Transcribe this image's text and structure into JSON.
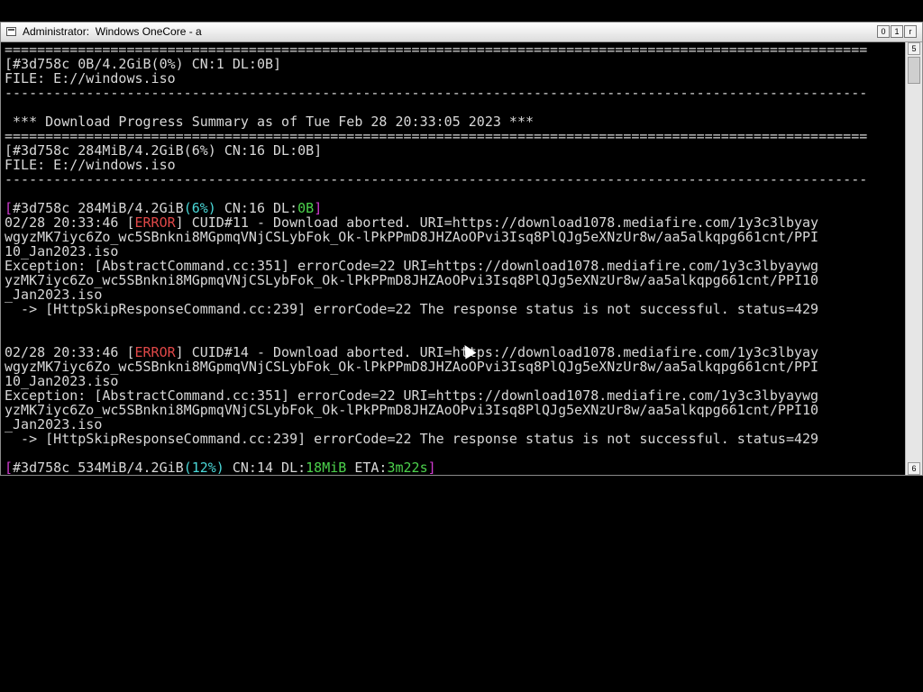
{
  "window": {
    "title": "Administrator:  Windows OneCore - a",
    "buttons": [
      "0",
      "1",
      "r"
    ],
    "scroll": {
      "up": "5",
      "down": "6"
    }
  },
  "console": {
    "lines": [
      {
        "segments": [
          {
            "text": "=========================================================================================================="
          }
        ]
      },
      {
        "segments": [
          {
            "text": "[#3d758c 0B/4.2GiB(0%) CN:1 DL:0B]"
          }
        ]
      },
      {
        "segments": [
          {
            "text": "FILE: E://windows.iso"
          }
        ]
      },
      {
        "segments": [
          {
            "text": "----------------------------------------------------------------------------------------------------------"
          }
        ]
      },
      {
        "segments": [
          {
            "text": ""
          }
        ]
      },
      {
        "segments": [
          {
            "text": " *** Download Progress Summary as of Tue Feb 28 20:33:05 2023 ***"
          }
        ]
      },
      {
        "segments": [
          {
            "text": "=========================================================================================================="
          }
        ]
      },
      {
        "segments": [
          {
            "text": "[#3d758c 284MiB/4.2GiB(6%) CN:16 DL:0B]"
          }
        ]
      },
      {
        "segments": [
          {
            "text": "FILE: E://windows.iso"
          }
        ]
      },
      {
        "segments": [
          {
            "text": "----------------------------------------------------------------------------------------------------------"
          }
        ]
      },
      {
        "segments": [
          {
            "text": ""
          }
        ]
      },
      {
        "segments": [
          {
            "text": "[",
            "color": "mag"
          },
          {
            "text": "#3d758c 284MiB/4.2GiB"
          },
          {
            "text": "(6%)",
            "color": "cyan"
          },
          {
            "text": " CN:16 DL:"
          },
          {
            "text": "0B",
            "color": "grn"
          },
          {
            "text": "]",
            "color": "mag"
          }
        ]
      },
      {
        "segments": [
          {
            "text": "02/28 20:33:46 ["
          },
          {
            "text": "ERROR",
            "color": "red"
          },
          {
            "text": "] CUID#11 - Download aborted. URI=https://download1078.mediafire.com/1y3c3lbyay"
          }
        ]
      },
      {
        "segments": [
          {
            "text": "wgyzMK7iyc6Zo_wc5SBnkni8MGpmqVNjCSLybFok_Ok-lPkPPmD8JHZAoOPvi3Isq8PlQJg5eXNzUr8w/aa5alkqpg661cnt/PPI"
          }
        ]
      },
      {
        "segments": [
          {
            "text": "10_Jan2023.iso"
          }
        ]
      },
      {
        "segments": [
          {
            "text": "Exception: [AbstractCommand.cc:351] errorCode=22 URI=https://download1078.mediafire.com/1y3c3lbyaywg"
          }
        ]
      },
      {
        "segments": [
          {
            "text": "yzMK7iyc6Zo_wc5SBnkni8MGpmqVNjCSLybFok_Ok-lPkPPmD8JHZAoOPvi3Isq8PlQJg5eXNzUr8w/aa5alkqpg661cnt/PPI10"
          }
        ]
      },
      {
        "segments": [
          {
            "text": "_Jan2023.iso"
          }
        ]
      },
      {
        "segments": [
          {
            "text": "  -> [HttpSkipResponseCommand.cc:239] errorCode=22 The response status is not successful. status=429"
          }
        ]
      },
      {
        "segments": [
          {
            "text": ""
          }
        ]
      },
      {
        "segments": [
          {
            "text": ""
          }
        ]
      },
      {
        "segments": [
          {
            "text": "02/28 20:33:46 ["
          },
          {
            "text": "ERROR",
            "color": "red"
          },
          {
            "text": "] CUID#14 - Download aborted. URI=https://download1078.mediafire.com/1y3c3lbyay"
          }
        ]
      },
      {
        "segments": [
          {
            "text": "wgyzMK7iyc6Zo_wc5SBnkni8MGpmqVNjCSLybFok_Ok-lPkPPmD8JHZAoOPvi3Isq8PlQJg5eXNzUr8w/aa5alkqpg661cnt/PPI"
          }
        ]
      },
      {
        "segments": [
          {
            "text": "10_Jan2023.iso"
          }
        ]
      },
      {
        "segments": [
          {
            "text": "Exception: [AbstractCommand.cc:351] errorCode=22 URI=https://download1078.mediafire.com/1y3c3lbyaywg"
          }
        ]
      },
      {
        "segments": [
          {
            "text": "yzMK7iyc6Zo_wc5SBnkni8MGpmqVNjCSLybFok_Ok-lPkPPmD8JHZAoOPvi3Isq8PlQJg5eXNzUr8w/aa5alkqpg661cnt/PPI10"
          }
        ]
      },
      {
        "segments": [
          {
            "text": "_Jan2023.iso"
          }
        ]
      },
      {
        "segments": [
          {
            "text": "  -> [HttpSkipResponseCommand.cc:239] errorCode=22 The response status is not successful. status=429"
          }
        ]
      },
      {
        "segments": [
          {
            "text": ""
          }
        ]
      },
      {
        "segments": [
          {
            "text": "[",
            "color": "mag"
          },
          {
            "text": "#3d758c 534MiB/4.2GiB"
          },
          {
            "text": "(12%)",
            "color": "cyan"
          },
          {
            "text": " CN:14 DL:"
          },
          {
            "text": "18MiB",
            "color": "grn"
          },
          {
            "text": " ETA:"
          },
          {
            "text": "3m22s",
            "color": "grn"
          },
          {
            "text": "]",
            "color": "mag"
          }
        ]
      }
    ]
  },
  "colors": {
    "console_bg": "#000000",
    "text": "#d8d8d8",
    "bracket": "#d23ad2",
    "percent": "#4ad8d8",
    "speed": "#4cd24c",
    "error": "#e04848"
  }
}
